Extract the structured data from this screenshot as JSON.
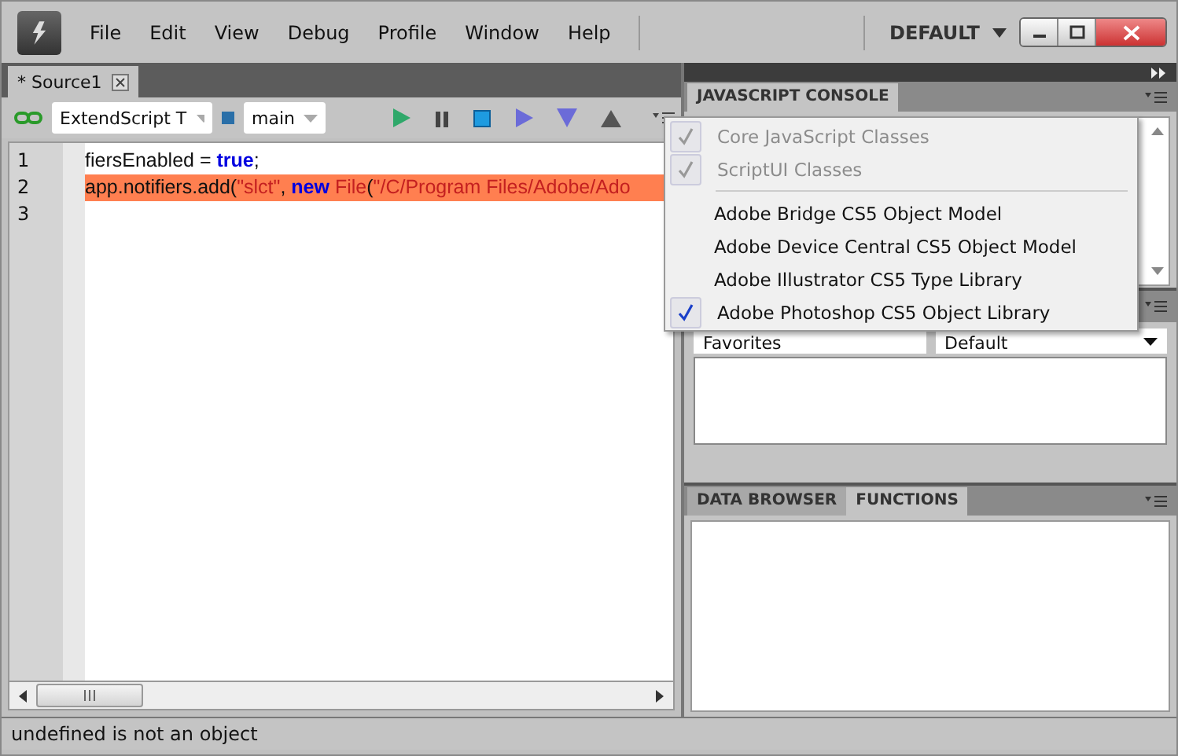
{
  "menu_bar": {
    "items": [
      "File",
      "Edit",
      "View",
      "Debug",
      "Profile",
      "Window",
      "Help"
    ],
    "workspace": "DEFAULT"
  },
  "editor": {
    "tabs": [
      {
        "label": "* Source1",
        "selected": true
      }
    ],
    "toolbar": {
      "engine": "ExtendScript T",
      "target": "main"
    },
    "lines": [
      {
        "number": "1",
        "highlighted": false,
        "tokens": [
          {
            "kind": "plain",
            "text": "fiersEnabled = "
          },
          {
            "kind": "keyword",
            "text": "true"
          },
          {
            "kind": "plain",
            "text": ";"
          }
        ]
      },
      {
        "number": "2",
        "highlighted": true,
        "tokens": [
          {
            "kind": "plain",
            "text": "app.notifiers.add("
          },
          {
            "kind": "string",
            "text": "\"slct\""
          },
          {
            "kind": "plain",
            "text": ", "
          },
          {
            "kind": "keyword",
            "text": "new"
          },
          {
            "kind": "string",
            "text": " File"
          },
          {
            "kind": "plain",
            "text": "("
          },
          {
            "kind": "string",
            "text": "\"/C/Program Files/Adobe/Ado"
          }
        ]
      },
      {
        "number": "3"
      }
    ]
  },
  "console": {
    "tabs": [
      {
        "label": "JAVASCRIPT CONSOLE",
        "selected": true
      }
    ]
  },
  "object_model": {
    "collection": "Favorites",
    "view": "Default"
  },
  "lower_panel": {
    "tabs": [
      {
        "label": "DATA BROWSER",
        "selected": false
      },
      {
        "label": "FUNCTIONS",
        "selected": true
      }
    ]
  },
  "dropdown_menu": {
    "groups": [
      [
        {
          "label": "Core JavaScript Classes",
          "checked": true,
          "disabled": true
        },
        {
          "label": "ScriptUI Classes",
          "checked": true,
          "disabled": true
        }
      ],
      [
        {
          "label": "Adobe Bridge CS5 Object Model",
          "checked": false,
          "disabled": false
        },
        {
          "label": "Adobe Device Central CS5 Object Model",
          "checked": false,
          "disabled": false
        },
        {
          "label": "Adobe Illustrator CS5 Type Library",
          "checked": false,
          "disabled": false
        },
        {
          "label": "Adobe Photoshop CS5 Object Library",
          "checked": true,
          "disabled": false
        }
      ]
    ]
  },
  "status_bar": {
    "message": "undefined is not an object"
  }
}
